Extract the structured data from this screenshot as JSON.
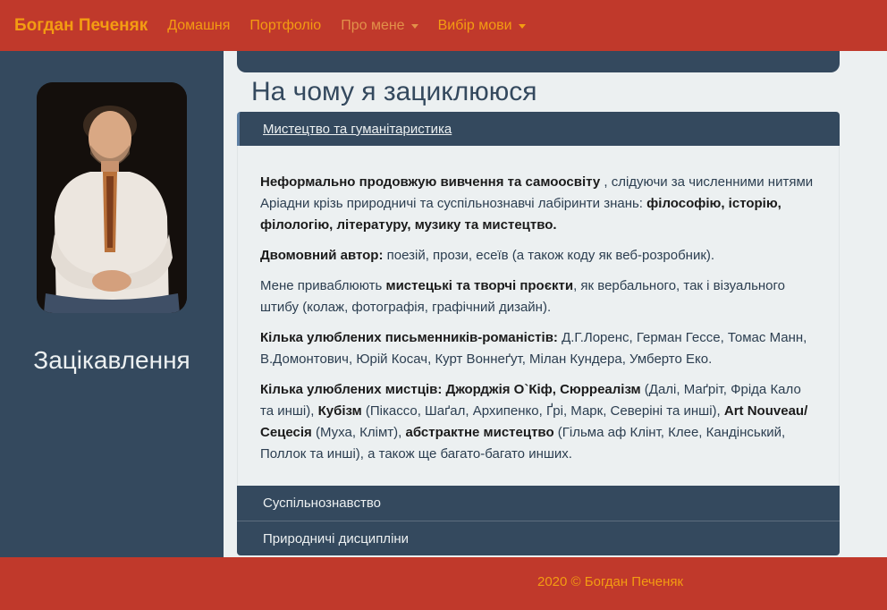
{
  "navbar": {
    "brand": "Богдан Печеняк",
    "links": [
      {
        "label": "Домашня"
      },
      {
        "label": "Портфоліо"
      },
      {
        "label": "Про мене"
      },
      {
        "label": "Вибір мови"
      }
    ]
  },
  "sidebar": {
    "title": "Зацікавлення"
  },
  "main": {
    "heading": "На чому я зациклююся",
    "accordion": [
      {
        "label": "Мистецтво та гуманітаристика",
        "expanded": true
      },
      {
        "label": "Суспільнознавство",
        "expanded": false
      },
      {
        "label": "Природничі дисципліни",
        "expanded": false
      }
    ],
    "body": {
      "p1_b1": "Неформально продовжую вивчення та самоосвіту",
      "p1_t1": " , слідуючи за численними нитями Аріадни крізь природничі та суспільнознавчі лабіринти знань: ",
      "p1_b2": "філософію, історію, філологію, літературу, музику та мистецтво.",
      "p2_b1": "Двомовний автор:",
      "p2_t1": " поезій, прози, есеїв (а також коду як веб-розробник).",
      "p3_t1": "Мене приваблюють ",
      "p3_b1": "мистецькі та творчі проєкти",
      "p3_t2": ", як вербального, так і візуального штибу (колаж, фотографія, графічний дизайн).",
      "p4_b1": "Кілька улюблених письменників-романістів:",
      "p4_t1": " Д.Г.Лоренс, Герман Гессе, Томас Манн, В.Домонтович, Юрій Косач, Курт Воннеґут, Мілан Кундера, Умберто Еко.",
      "p5_b1": "Кілька улюблених мистців: Джорджія О`Кіф, Сюрреалізм",
      "p5_t1": " (Далі, Маґріт, Фріда Кало та инші), ",
      "p5_b2": "Кубізм",
      "p5_t2": " (Пікассо, Шаґал, Архипенко, Ґрі, Марк, Северіні та инші), ",
      "p5_b3": "Art Nouveau/Сецесія",
      "p5_t3": " (Муха, Клімт), ",
      "p5_b4": "абстрактне мистецтво",
      "p5_t4": " (Гільма аф Клінт, Клее, Кандінський, Поллок та инші), а також ще багато-багато инших."
    }
  },
  "footer": {
    "text": "2020 © Богдан Печеняк"
  },
  "colors": {
    "navbar_bg": "#c0392b",
    "accent": "#f39c12",
    "sidebar_bg": "#34495e",
    "page_bg": "#ecf0f1"
  }
}
